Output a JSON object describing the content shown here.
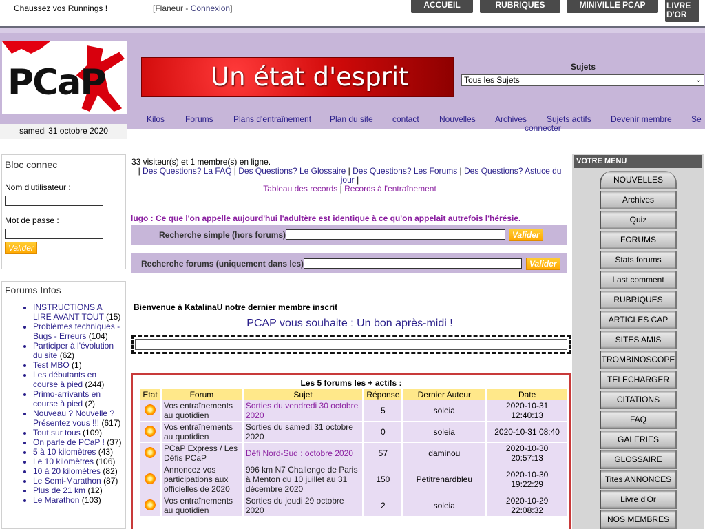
{
  "topbar": {
    "promo": "Chaussez vos Runnings !",
    "user_prefix": "[Flaneur - ",
    "connect": "Connexion",
    "user_suffix": "]",
    "buttons": [
      "ACCUEIL",
      "RUBRIQUES",
      "MINIVILLE PCAP",
      "LIVRE D'OR"
    ]
  },
  "header": {
    "logo_text": "PCaP",
    "banner_text": "Un état d'esprit",
    "sujets_label": "Sujets",
    "sujets_selected": "Tous les Sujets"
  },
  "nav": {
    "items": [
      "Kilos",
      "Forums",
      "Plans d'entraînement",
      "Plan du site",
      "contact",
      "Nouvelles",
      "Archives",
      "Sujets actifs",
      "Devenir membre",
      "Se"
    ],
    "sub": "connecter"
  },
  "left": {
    "date": "samedi 31 octobre 2020",
    "login": {
      "title": "Bloc connec",
      "username_label": "Nom d'utilisateur :",
      "password_label": "Mot de passe :",
      "submit": "Valider"
    },
    "forums": {
      "title": "Forums Infos",
      "items": [
        {
          "label": "INSTRUCTIONS A LIRE AVANT TOUT",
          "count": "(15)"
        },
        {
          "label": "Problèmes techniques - Bugs - Erreurs",
          "count": "(104)"
        },
        {
          "label": "Participer à l'évolution du site",
          "count": "(62)"
        },
        {
          "label": "Test MBO",
          "count": "(1)"
        },
        {
          "label": "Les débutants en course à pied",
          "count": "(244)"
        },
        {
          "label": "Primo-arrivants en course à pied",
          "count": "(2)"
        },
        {
          "label": "Nouveau ? Nouvelle ? Présentez vous !!!",
          "count": "(617)"
        },
        {
          "label": "Tout sur tous",
          "count": "(109)"
        },
        {
          "label": "On parle de PCaP !",
          "count": "(37)"
        },
        {
          "label": "5 à 10 kilomètres",
          "count": "(43)"
        },
        {
          "label": "Le 10 kilomètres",
          "count": "(106)"
        },
        {
          "label": "10 à 20 kilomètres",
          "count": "(82)"
        },
        {
          "label": "Le Semi-Marathon",
          "count": "(87)"
        },
        {
          "label": "Plus de 21 km",
          "count": "(12)"
        },
        {
          "label": "Le Marathon",
          "count": "(103)"
        }
      ]
    }
  },
  "center": {
    "visitors": "33 visiteur(s) et 1 membre(s) en ligne.",
    "quicklinks": {
      "sep": "|",
      "links": [
        "Des Questions? La FAQ",
        "Des Questions? Le Glossaire",
        "Des Questions? Les Forums",
        "Des Questions? Astuce du jour"
      ],
      "links2": [
        "Tableau des records",
        "Records à l'entraînement"
      ]
    },
    "quote": "lugo : Ce que l'on appelle aujourd'hui l'adultère est identique à ce qu'on appelait autrefois l'hérésie.",
    "search_simple": {
      "label": "Recherche simple (hors forums)",
      "button": "Valider"
    },
    "search_forums": {
      "label": "Recherche forums (uniquement dans les)",
      "button": "Valider"
    },
    "welcome": "Bienvenue à KatalinaU notre dernier membre inscrit",
    "greeting": "PCAP vous souhaite : Un bon après-midi !",
    "active": {
      "title": "Les 5 forums les + actifs :",
      "headers": [
        "Etat",
        "Forum",
        "Sujet",
        "Réponse",
        "Dernier Auteur",
        "Date"
      ],
      "rows": [
        {
          "forum": "Vos entraînements au quotidien",
          "sujet": "Sorties du vendredi 30 octobre 2020",
          "link": true,
          "reponse": "5",
          "auteur": "soleia",
          "date": "2020-10-31 12:40:13"
        },
        {
          "forum": "Vos entraînements au quotidien",
          "sujet": "Sorties du samedi 31 octobre 2020",
          "link": false,
          "reponse": "0",
          "auteur": "soleia",
          "date": "2020-10-31 08:40"
        },
        {
          "forum": "PCaP Express / Les Défis PCaP",
          "sujet": "Défi Nord-Sud : octobre 2020",
          "link": true,
          "reponse": "57",
          "auteur": "daminou",
          "date": "2020-10-30 20:57:13"
        },
        {
          "forum": "Annoncez vos participations aux officielles de 2020",
          "sujet": "996 km N7 Challenge de Paris à Menton du 10 juillet au 31 décembre 2020",
          "link": false,
          "reponse": "150",
          "auteur": "Petitrenardbleu",
          "date": "2020-10-30 19:22:29"
        },
        {
          "forum": "Vos entraînements au quotidien",
          "sujet": "Sorties du jeudi 29 octobre 2020",
          "link": false,
          "reponse": "2",
          "auteur": "soleia",
          "date": "2020-10-29 22:08:32"
        }
      ]
    }
  },
  "rightmenu": {
    "title": "VOTRE MENU",
    "items": [
      "NOUVELLES",
      "Archives",
      "Quiz",
      "FORUMS",
      "Stats forums",
      "Last comment",
      "RUBRIQUES",
      "ARTICLES CAP",
      "SITES AMIS",
      "TROMBINOSCOPE",
      "TELECHARGER",
      "CITATIONS",
      "FAQ",
      "GALERIES",
      "GLOSSAIRE",
      "Tites ANNONCES",
      "Livre d'Or",
      "NOS MEMBRES"
    ]
  }
}
